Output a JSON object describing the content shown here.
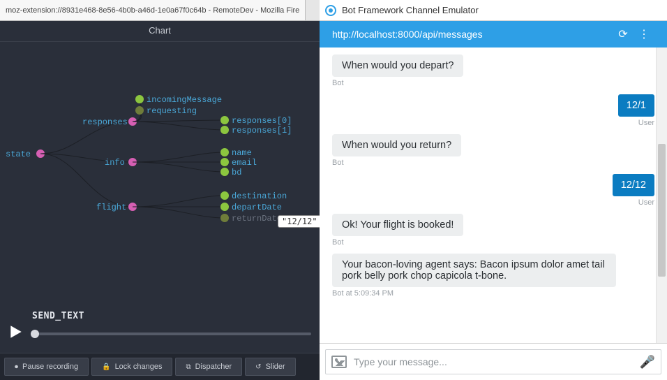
{
  "left": {
    "tab_title": "moz-extension://8931e468-8e56-4b0b-a46d-1e0a67f0c64b - RemoteDev - Mozilla Fire",
    "header": "Chart",
    "tree": {
      "root": "state",
      "groups": [
        {
          "key": "responses",
          "children": [
            {
              "label": "incomingMessage",
              "color": "#8cc63f"
            },
            {
              "label": "requesting",
              "color": "#6f7d3a"
            },
            {
              "label": "responses[0]",
              "color": "#8cc63f"
            },
            {
              "label": "responses[1]",
              "color": "#8cc63f"
            }
          ]
        },
        {
          "key": "info",
          "children": [
            {
              "label": "name",
              "color": "#8cc63f"
            },
            {
              "label": "email",
              "color": "#8cc63f"
            },
            {
              "label": "bd",
              "color": "#8cc63f"
            }
          ]
        },
        {
          "key": "flight",
          "children": [
            {
              "label": "destination",
              "color": "#8cc63f"
            },
            {
              "label": "departDate",
              "color": "#8cc63f"
            },
            {
              "label": "returnDate",
              "color": "#6c7380",
              "dim": true
            }
          ]
        }
      ],
      "tooltip": "\"12/12\""
    },
    "action_name": "SEND_TEXT",
    "toolbar": [
      {
        "icon": "⏺",
        "label": "Pause recording"
      },
      {
        "icon": "🔒",
        "label": "Lock changes"
      },
      {
        "icon": "⧉",
        "label": "Dispatcher"
      },
      {
        "icon": "↺",
        "label": "Slider"
      }
    ]
  },
  "right": {
    "window_title": "Bot Framework Channel Emulator",
    "url": "http://localhost:8000/api/messages",
    "messages": [
      {
        "from": "bot",
        "text": "When would you depart?",
        "meta": "Bot"
      },
      {
        "from": "user",
        "text": "12/1",
        "meta": "User"
      },
      {
        "from": "bot",
        "text": "When would you return?",
        "meta": "Bot"
      },
      {
        "from": "user",
        "text": "12/12",
        "meta": "User"
      },
      {
        "from": "bot",
        "text": "Ok! Your flight is booked!",
        "meta": "Bot"
      },
      {
        "from": "bot",
        "text": "Your bacon-loving agent says: Bacon ipsum dolor amet tail pork belly pork chop capicola t-bone.",
        "meta": "Bot at 5:09:34 PM"
      }
    ],
    "compose_placeholder": "Type your message..."
  }
}
